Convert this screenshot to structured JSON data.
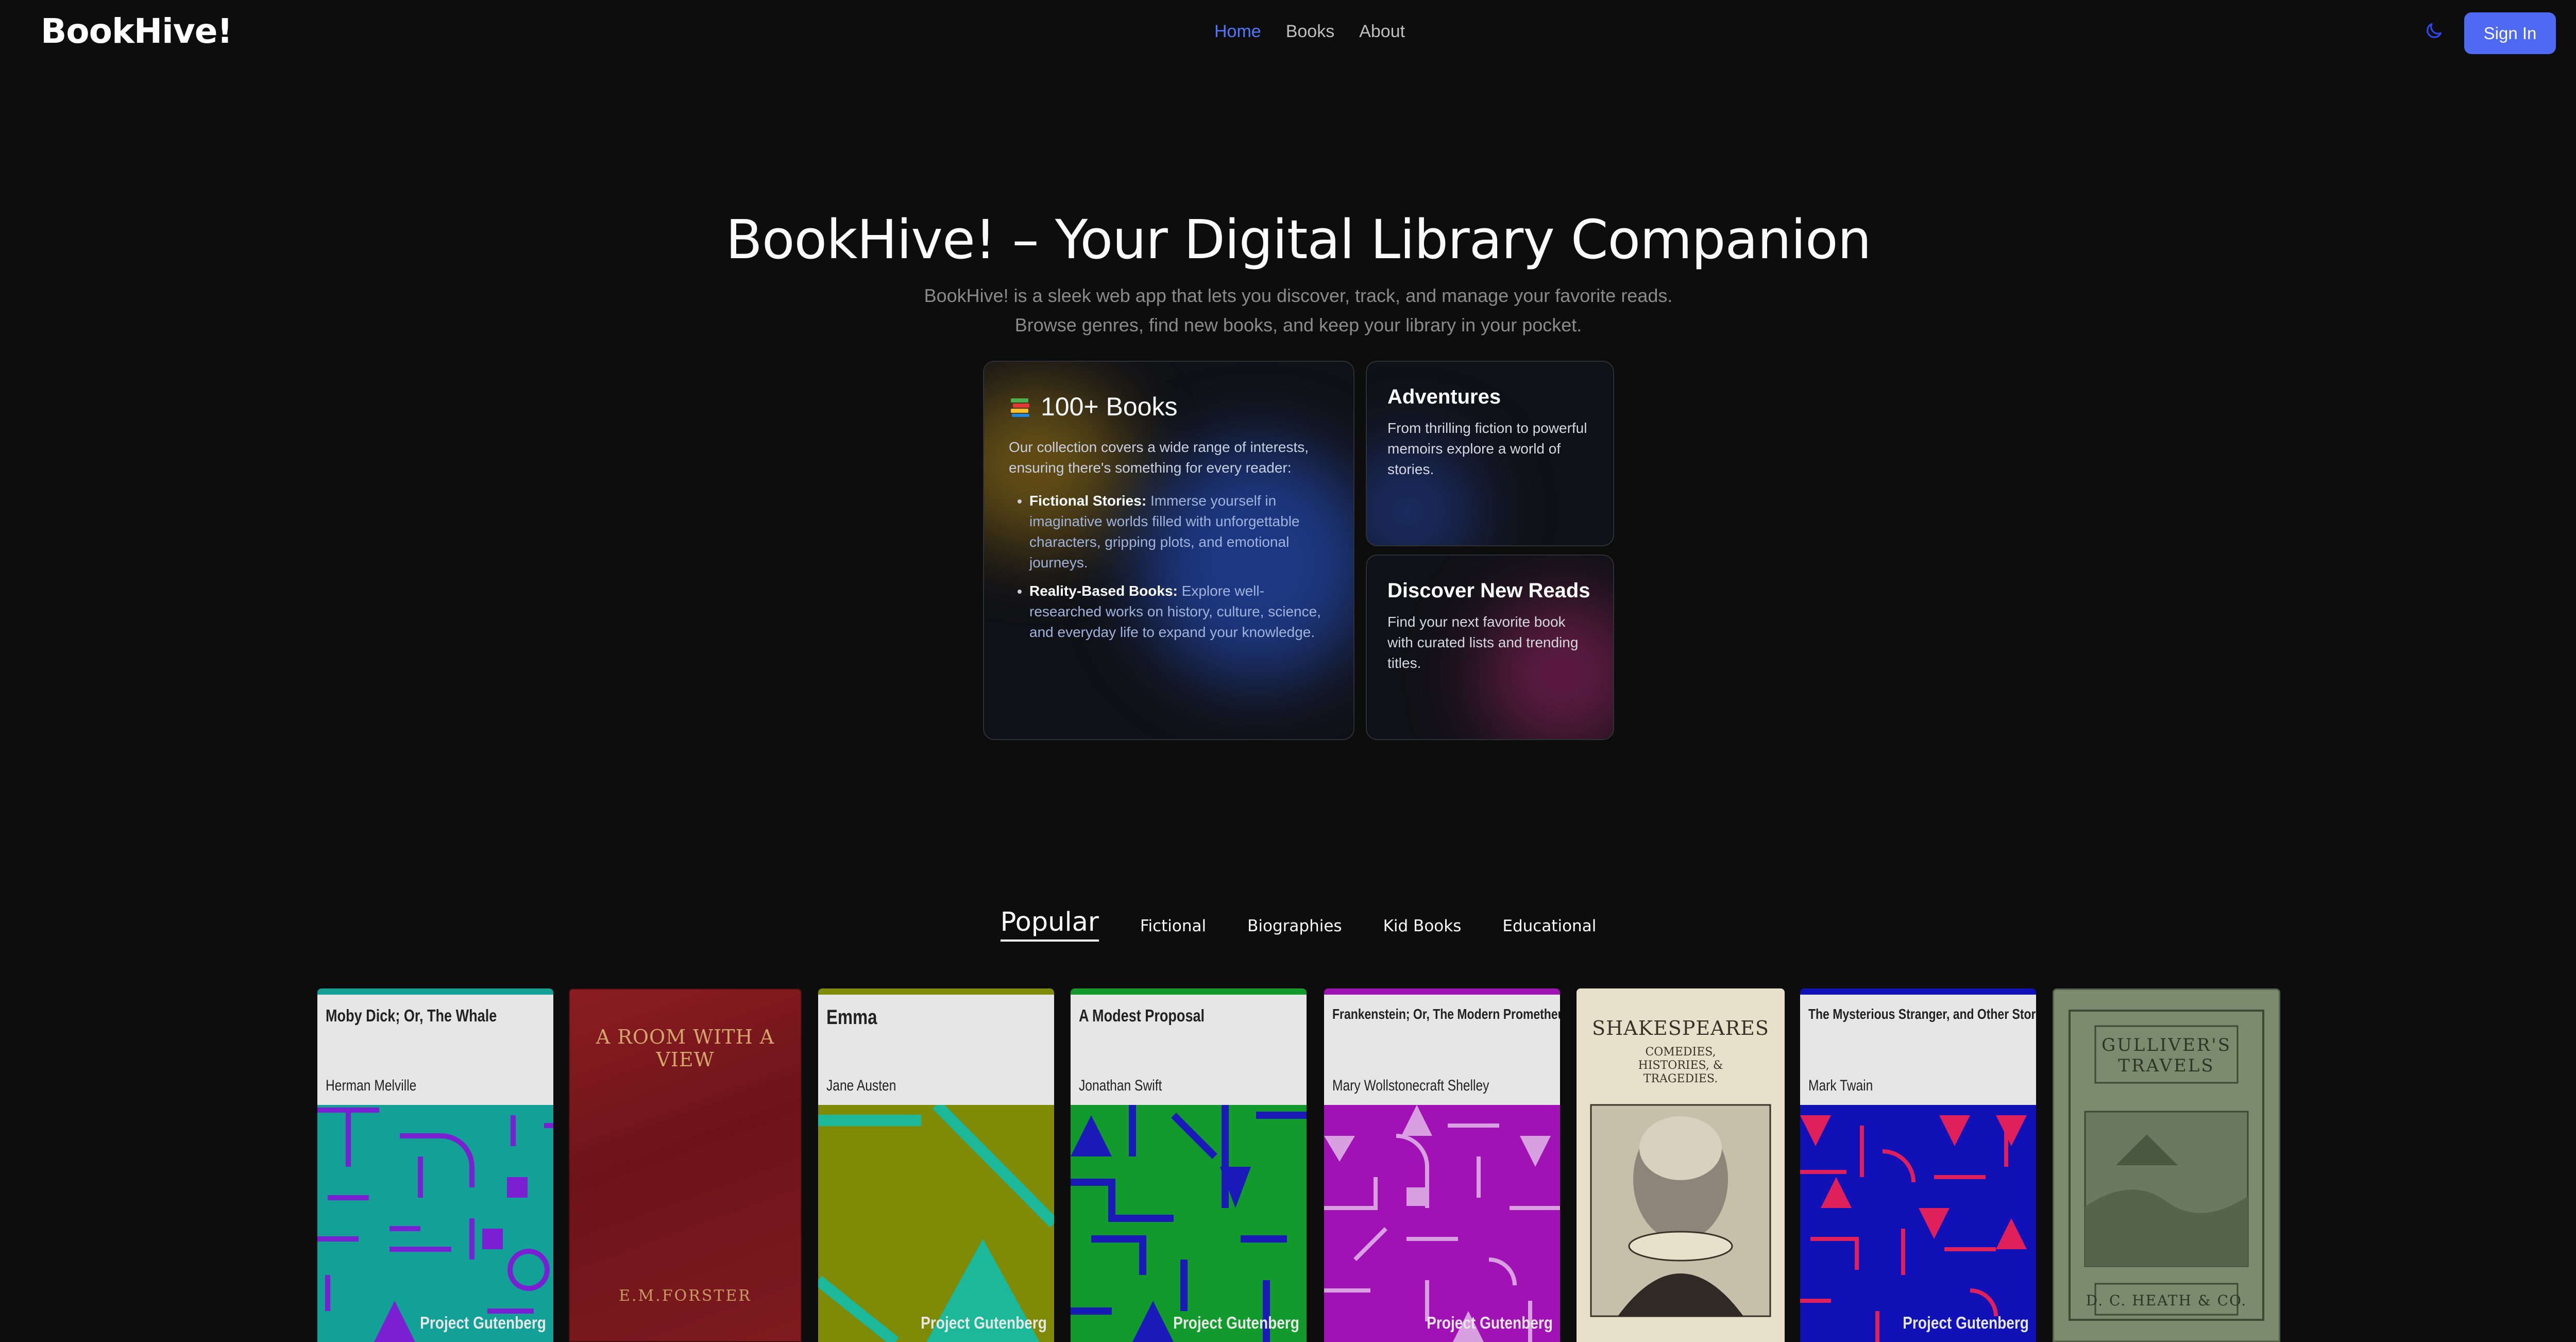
{
  "header": {
    "logo": "BookHive!",
    "nav": [
      "Home",
      "Books",
      "About"
    ],
    "theme_icon": "moon-icon",
    "signin_label": "Sign In"
  },
  "hero": {
    "title": "BookHive! – Your Digital Library Companion",
    "subtitle_line1": "BookHive! is a sleek web app that lets you discover, track, and manage your favorite reads.",
    "subtitle_line2": "Browse genres, find new books, and keep your library in your pocket."
  },
  "features": {
    "main": {
      "icon": "books-stack-icon",
      "title": "100+ Books",
      "intro": "Our collection covers a wide range of interests, ensuring there's something for every reader:",
      "items": [
        {
          "label": "Fictional Stories:",
          "text": "Immerse yourself in imaginative worlds filled with unforgettable characters, gripping plots, and emotional journeys."
        },
        {
          "label": "Reality-Based Books:",
          "text": "Explore well-researched works on history, culture, science, and everyday life to expand your knowledge."
        }
      ]
    },
    "adventures": {
      "title": "Adventures",
      "text": "From thrilling fiction to powerful memoirs explore a world of stories."
    },
    "discover": {
      "title": "Discover New Reads",
      "text": "Find your next favorite book with curated lists and trending titles."
    }
  },
  "tabs": [
    "Popular",
    "Fictional",
    "Biographies",
    "Kid Books",
    "Educational"
  ],
  "books": [
    {
      "title": "Moby Dick; Or, The Whale",
      "author": "Herman Melville",
      "brand": "Project Gutenberg",
      "color": "#13a197",
      "accent": "#7a1fd1"
    },
    {
      "title": "A ROOM WITH A VIEW",
      "author": "E.M.FORSTER"
    },
    {
      "title": "Emma",
      "author": "Jane Austen",
      "brand": "Project Gutenberg",
      "color": "#7f8a06",
      "accent": "#1bb89a"
    },
    {
      "title": "A Modest Proposal",
      "author": "Jonathan Swift",
      "brand": "Project Gutenberg",
      "color": "#129a2d",
      "accent": "#1a1ab8"
    },
    {
      "title": "Frankenstein; Or, The Modern Prometheus",
      "author": "Mary Wollstonecraft Shelley",
      "brand": "Project Gutenberg",
      "color": "#a012b4",
      "accent": "#d8a0e0"
    },
    {
      "title": "SHAKESPEARES COMEDIES, HISTORIES, & TRAGEDIES"
    },
    {
      "title": "The Mysterious Stranger, and Other Stories",
      "author": "Mark Twain",
      "brand": "Project Gutenberg",
      "color": "#1111b8",
      "accent": "#e0205a"
    },
    {
      "title": "GULLIVER'S TRAVELS",
      "author": "D. C. HEATH & CO."
    }
  ]
}
